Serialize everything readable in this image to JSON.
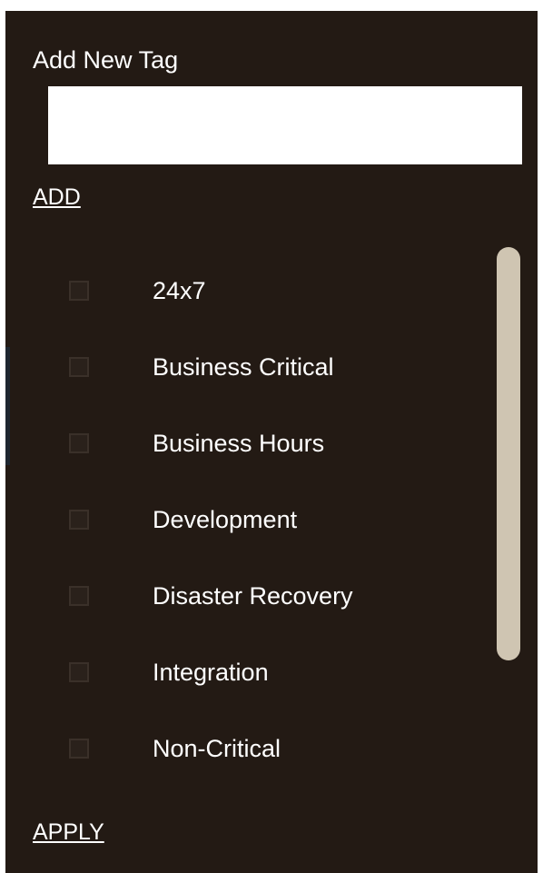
{
  "header": {
    "title": "Add New Tag"
  },
  "new_tag_input": {
    "value": "",
    "placeholder": ""
  },
  "actions": {
    "add_label": "ADD",
    "apply_label": "APPLY"
  },
  "tags": [
    {
      "label": "24x7",
      "checked": false
    },
    {
      "label": "Business Critical",
      "checked": false
    },
    {
      "label": "Business Hours",
      "checked": false
    },
    {
      "label": "Development",
      "checked": false
    },
    {
      "label": "Disaster Recovery",
      "checked": false
    },
    {
      "label": "Integration",
      "checked": false
    },
    {
      "label": "Non-Critical",
      "checked": false
    }
  ],
  "colors": {
    "panel_background": "#231a14",
    "text": "#ffffff",
    "scrollbar_thumb": "#cfc5b2",
    "checkbox_border": "#3a3029"
  }
}
